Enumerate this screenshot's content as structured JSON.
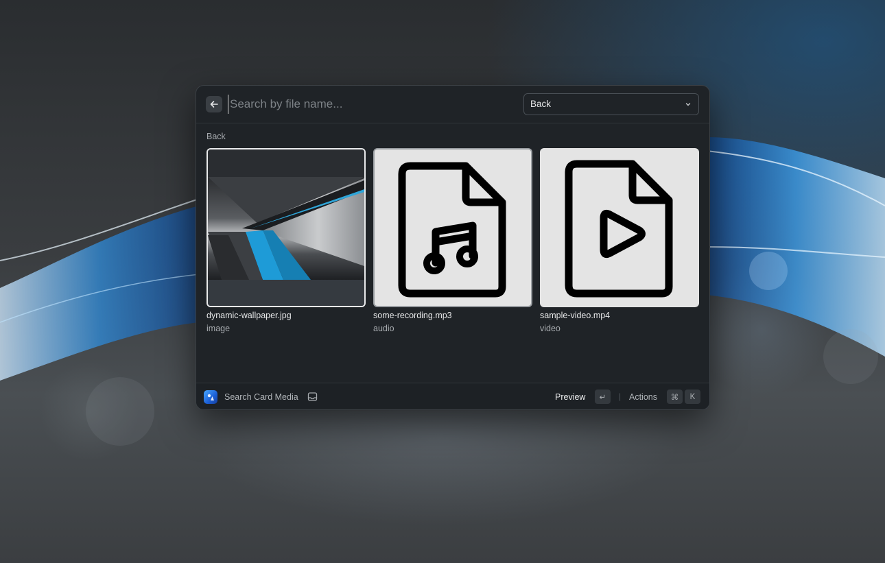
{
  "search": {
    "placeholder": "Search by file name...",
    "value": ""
  },
  "filter_dropdown": {
    "selected": "Back"
  },
  "section": {
    "label": "Back"
  },
  "items": [
    {
      "name": "dynamic-wallpaper.jpg",
      "type": "image",
      "state": "selected"
    },
    {
      "name": "some-recording.mp3",
      "type": "audio",
      "state": "hovered"
    },
    {
      "name": "sample-video.mp4",
      "type": "video",
      "state": "normal"
    }
  ],
  "footer": {
    "title": "Search Card Media",
    "primary_action": "Preview",
    "primary_key": "↵",
    "actions_label": "Actions",
    "actions_keys": [
      "⌘",
      "K"
    ]
  },
  "colors": {
    "window_bg": "#1f2327",
    "accent_blue": "#1e9bd7",
    "icon_tile_bg": "#e4e4e4"
  }
}
